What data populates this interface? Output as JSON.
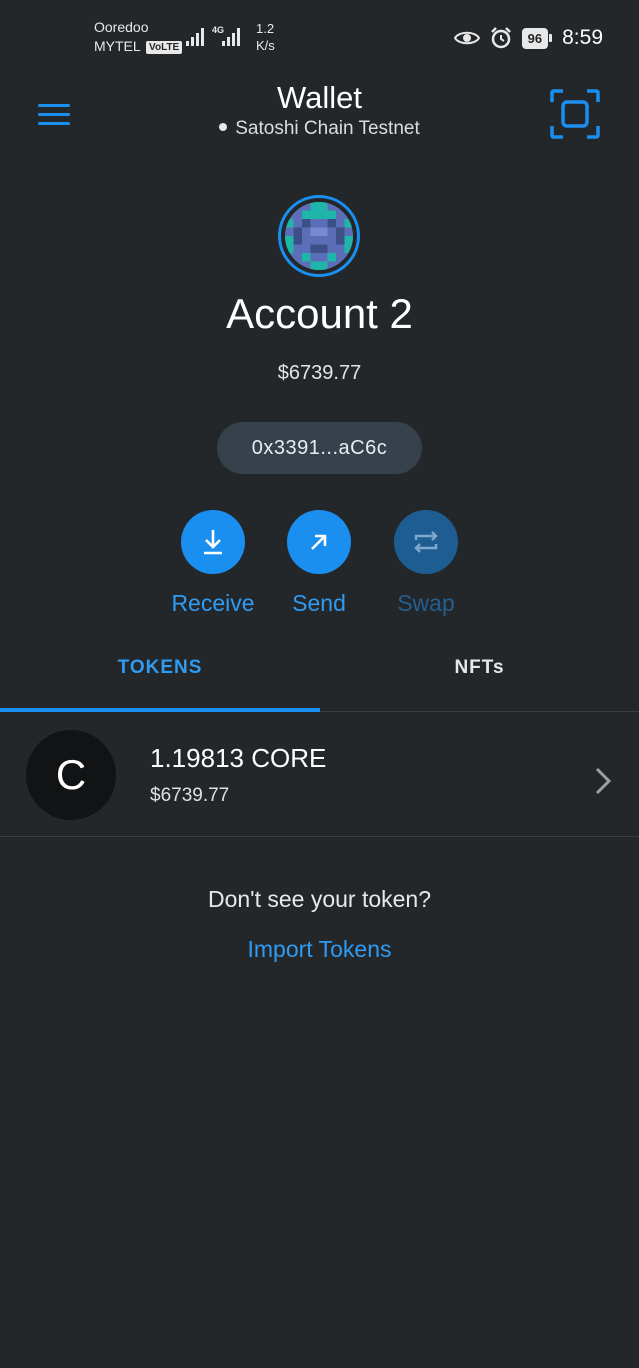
{
  "status_bar": {
    "carrier_top": "Ooredoo",
    "carrier_bottom": "MYTEL",
    "volte_badge": "VoLTE",
    "network_type": "4G",
    "speed_value": "1.2",
    "speed_unit": "K/s",
    "battery_level": "96",
    "time": "8:59",
    "icons": [
      "signal-bars-icon",
      "eye-icon",
      "alarm-icon",
      "battery-icon"
    ]
  },
  "header": {
    "title": "Wallet",
    "network_name": "Satoshi Chain Testnet",
    "menu_icon": "hamburger-menu-icon",
    "scan_icon": "qr-scan-icon",
    "accent_color": "#1a8ff0"
  },
  "account": {
    "name": "Account 2",
    "balance": "$6739.77",
    "address": "0x3391...aC6c"
  },
  "actions": [
    {
      "label": "Receive",
      "icon": "download-icon",
      "enabled": true
    },
    {
      "label": "Send",
      "icon": "arrow-up-right-icon",
      "enabled": true
    },
    {
      "label": "Swap",
      "icon": "swap-arrows-icon",
      "enabled": false
    }
  ],
  "tabs": [
    {
      "label": "TOKENS",
      "active": true
    },
    {
      "label": "NFTs",
      "active": false
    }
  ],
  "tokens": [
    {
      "logo_letter": "C",
      "amount": "1.19813 CORE",
      "fiat": "$6739.77"
    }
  ],
  "import": {
    "prompt": "Don't see your token?",
    "link": "Import Tokens"
  }
}
